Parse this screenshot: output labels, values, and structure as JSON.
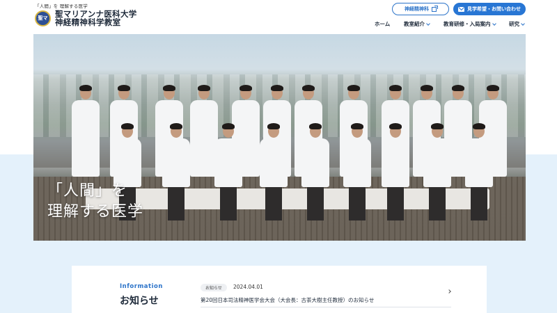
{
  "header": {
    "tagline": "「人間」を 理解する医学",
    "logo_emblem": "聖マ",
    "logo_line1": "聖マリアンナ医科大学",
    "logo_line2": "神経精神科学教室",
    "btn_psychiatry": "神経精神科",
    "btn_contact": "見学希望・お問い合わせ"
  },
  "nav": {
    "items": [
      {
        "label": "ホーム",
        "has_dropdown": false
      },
      {
        "label": "教室紹介",
        "has_dropdown": true
      },
      {
        "label": "教育研修・入局案内",
        "has_dropdown": true
      },
      {
        "label": "研究",
        "has_dropdown": true
      }
    ]
  },
  "hero": {
    "line1": "「人間」を",
    "line2": "理解する医学"
  },
  "info": {
    "heading_en": "Information",
    "heading_ja": "お知らせ",
    "news": [
      {
        "badge": "お知らせ",
        "date": "2024.04.01",
        "title": "第20回日本司法精神医学会大会（大会長：古茶大樹主任教授）のお知らせ"
      }
    ]
  },
  "colors": {
    "accent": "#2876d4",
    "band": "#e4f1fb",
    "text": "#1e2a3a"
  }
}
